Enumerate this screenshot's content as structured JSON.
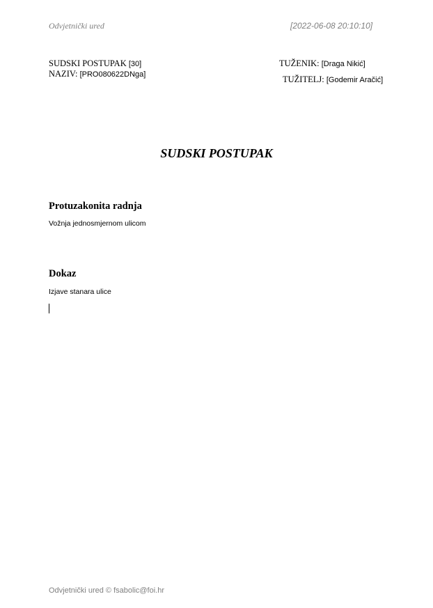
{
  "header": {
    "office_name": "Odvjetnički ured",
    "timestamp": "[2022-06-08 20:10:10]"
  },
  "case": {
    "procedure_label": "SUDSKI POSTUPAK",
    "procedure_number": "[30]",
    "name_label": "NAZIV:",
    "name_value": "[PRO080622DNga]",
    "defendant_label": "TUŽENIK:",
    "defendant_value": "[Draga Nikić]",
    "plaintiff_label": "TUŽITELJ:",
    "plaintiff_value": "[Godemir Aračić]"
  },
  "document": {
    "title": "SUDSKI POSTUPAK",
    "sections": [
      {
        "heading": "Protuzakonita radnja",
        "body": "Vožnja jednosmjernom ulicom"
      },
      {
        "heading": "Dokaz",
        "body": "Izjave stanara ulice"
      }
    ]
  },
  "footer": {
    "text": "Odvjetnički ured © fsabolic@foi.hr"
  }
}
